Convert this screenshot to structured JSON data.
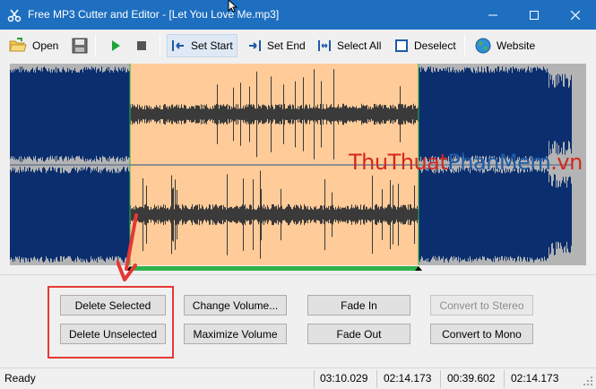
{
  "window": {
    "title": "Free MP3 Cutter and Editor - [Let You Love Me.mp3]",
    "accent": "#1e6fc0"
  },
  "toolbar": {
    "open": "Open",
    "set_start": "Set Start",
    "set_end": "Set End",
    "select_all": "Select All",
    "deselect": "Deselect",
    "website": "Website"
  },
  "waveform": {
    "selection_start": 0.209,
    "selection_end": 0.709,
    "colors": {
      "unselected": "#0a2e6e",
      "selected_bg": "#ffcc99",
      "center_line": "#6b7a8f",
      "progress": "#2fb14b"
    }
  },
  "watermark": {
    "part1": "ThuThuat",
    "part2": "PhanMem",
    "part3": ".vn"
  },
  "buttons": {
    "delete_selected": "Delete Selected",
    "delete_unselected": "Delete Unselected",
    "change_volume": "Change Volume...",
    "maximize_volume": "Maximize Volume",
    "fade_in": "Fade In",
    "fade_out": "Fade Out",
    "convert_stereo": "Convert to Stereo",
    "convert_mono": "Convert to Mono"
  },
  "status": {
    "state": "Ready",
    "total": "03:10.029",
    "start": "02:14.173",
    "length": "00:39.602",
    "end": "02:14.173"
  }
}
